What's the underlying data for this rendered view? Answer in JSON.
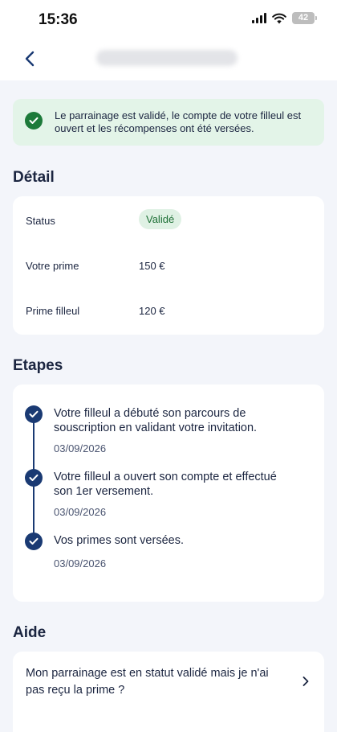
{
  "status_bar": {
    "time": "15:36",
    "battery": "42"
  },
  "alert": {
    "message": "Le parrainage est validé, le compte de votre filleul est ouvert et les récompenses ont été versées."
  },
  "detail": {
    "title": "Détail",
    "rows": [
      {
        "label": "Status",
        "value": "Validé"
      },
      {
        "label": "Votre prime",
        "value": "150 €"
      },
      {
        "label": "Prime filleul",
        "value": "120 €"
      }
    ]
  },
  "steps": {
    "title": "Etapes",
    "items": [
      {
        "text": "Votre filleul a débuté son parcours de souscription en validant votre invitation.",
        "date": "03/09/2026"
      },
      {
        "text": "Votre filleul a ouvert son compte et effectué son 1er versement.",
        "date": "03/09/2026"
      },
      {
        "text": "Vos primes sont versées.",
        "date": "03/09/2026"
      }
    ]
  },
  "help": {
    "title": "Aide",
    "items": [
      {
        "question": "Mon parrainage est en statut validé mais je n'ai pas reçu la prime ?"
      }
    ]
  },
  "colors": {
    "accent": "#1a3a73",
    "success": "#1d7a3a",
    "success_bg": "#e3f4e8",
    "page_bg": "#f3f5fa"
  },
  "icons": [
    "back-chevron-icon",
    "check-circle-icon",
    "check-icon",
    "chevron-right-icon",
    "wifi-icon",
    "signal-icon",
    "battery-icon"
  ]
}
